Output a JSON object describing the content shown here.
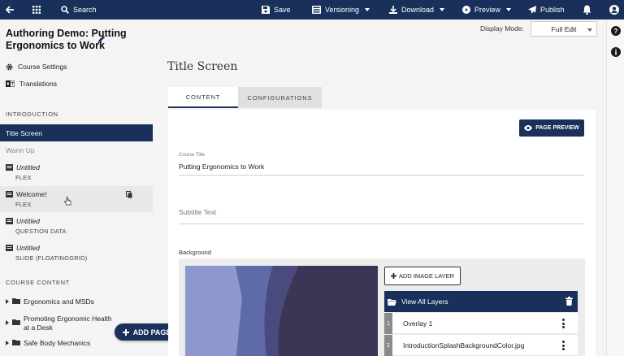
{
  "toolbar": {
    "search_label": "Search",
    "save_label": "Save",
    "versioning_label": "Versioning",
    "download_label": "Download",
    "preview_label": "Preview",
    "publish_label": "Publish"
  },
  "help": {
    "label": "?"
  },
  "project": {
    "title": "Authoring Demo: Putting Ergonomics to Work"
  },
  "sidebar": {
    "course_settings": "Course Settings",
    "translations": "Translations",
    "introduction_header": "INTRODUCTION",
    "active_page": "Title Screen",
    "warm_up": "Warm Up",
    "pages": [
      {
        "title": "Untitled",
        "subtitle": "FLEX"
      },
      {
        "title": "Welcome!",
        "subtitle": "FLEX"
      },
      {
        "title": "Untitled",
        "subtitle": "QUESTION DATA"
      },
      {
        "title": "Untitled",
        "subtitle": "SLIDE (FLOATINGGRID)"
      }
    ],
    "course_content_header": "COURSE CONTENT",
    "tree": [
      {
        "label": "Ergonomics and MSDs"
      },
      {
        "label": "Promoting Ergonomic Health at a Desk"
      },
      {
        "label": "Safe Body Mechanics"
      }
    ],
    "add_page_label": "ADD PAGE"
  },
  "main": {
    "display_mode_label": "Display Mode:",
    "display_mode_value": "Full Edit",
    "title": "Title Screen",
    "tabs": [
      {
        "label": "CONTENT"
      },
      {
        "label": "CONFIGURATIONS"
      }
    ],
    "page_preview_label": "PAGE PREVIEW",
    "course_title_label": "Course Title",
    "course_title_value": "Putting Ergonomics to Work",
    "subtitle_placeholder": "Subtitle Text",
    "background_label": "Background",
    "add_image_layer_label": "ADD IMAGE LAYER",
    "view_all_layers_label": "View All Layers",
    "layers": [
      {
        "index": "1",
        "name": "Overlay 1"
      },
      {
        "index": "2",
        "name": "IntroductionSplashBackgroundColor.jpg"
      }
    ]
  },
  "colors": {
    "primary": "#18305a",
    "active_tab_underline": "#18305a"
  }
}
